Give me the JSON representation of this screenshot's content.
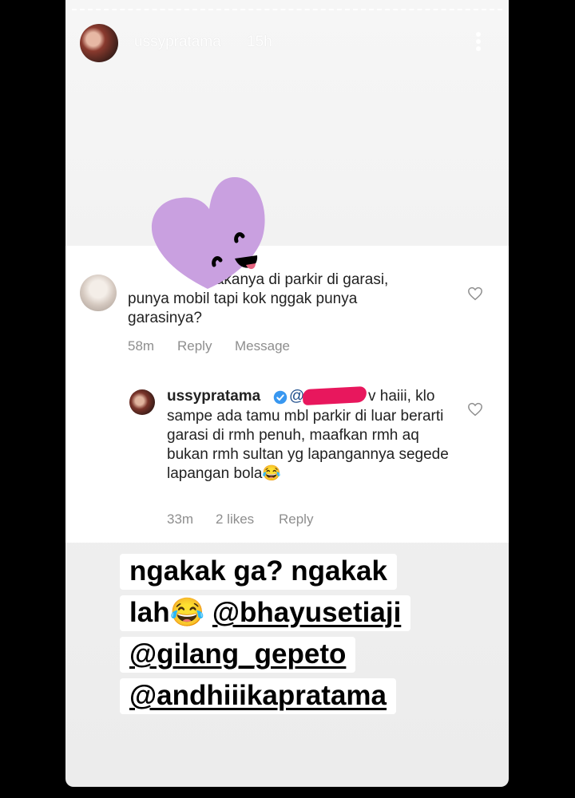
{
  "story": {
    "username": "ussypratama",
    "time": "15h"
  },
  "comment": {
    "text": "Makanya di parkir di garasi, punya mobil tapi kok nggak punya garasinya?",
    "time": "58m",
    "reply_label": "Reply",
    "message_label": "Message"
  },
  "reply": {
    "username": "ussypratama",
    "mention_prefix": "@",
    "text_first_line": "v haiii, klo",
    "text": "sampe ada tamu mbl parkir di luar berarti garasi di rmh penuh, maafkan rmh aq bukan rmh sultan yg lapangannya segede lapangan bola😂",
    "time": "33m",
    "likes": "2 likes",
    "reply_label": "Reply"
  },
  "caption": {
    "line1": "ngakak ga? ngakak",
    "line2_prefix": "lah😂 ",
    "mention1": "@bhayusetiaji",
    "mention2": "@gilang_gepeto",
    "mention3": "@andhiiikapratama"
  },
  "colors": {
    "sticker": "#c9a0e0",
    "redaction": "#e8175d",
    "verified": "#3897f0"
  },
  "icons": [
    "more-options-icon",
    "heart-icon",
    "verified-badge-icon",
    "heart-face-sticker"
  ]
}
